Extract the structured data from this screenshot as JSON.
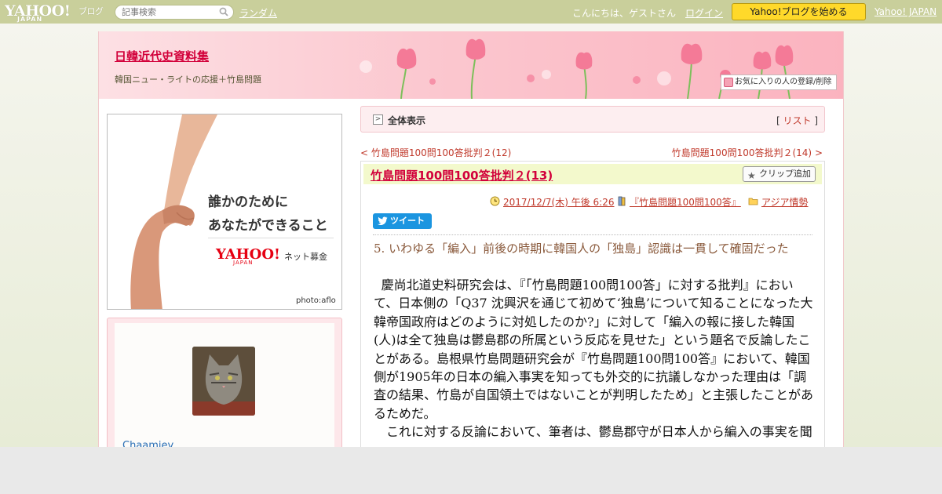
{
  "topbar": {
    "logo_main": "YAHOO!",
    "logo_sub": "JAPAN",
    "logo_service": "ブログ",
    "search_placeholder": "記事検索",
    "random_link": "ランダム",
    "greeting": "こんにちは、ゲストさん",
    "login_link": "ログイン",
    "start_button": "Yahoo!ブログを始める",
    "yahoo_japan_link": "Yahoo! JAPAN"
  },
  "blog": {
    "title": "日韓近代史資料集",
    "description": "韓国ニュー・ライトの応援＋竹島問題",
    "favorite_button": "お気に入りの人の登録/削除"
  },
  "sidebar": {
    "ad": {
      "line1": "誰かのために",
      "line2": "あなたができること",
      "brand": "YAHOO!",
      "brand_sub": "JAPAN",
      "brand_tail": "ネット募金",
      "credit": "photo:aflo"
    },
    "profile": {
      "name": "Chaamiey"
    }
  },
  "breadcrumb": {
    "label": "全体表示",
    "list_open": "[ ",
    "list_link": "リスト",
    "list_close": " ]"
  },
  "nav": {
    "prev_arrow": "< ",
    "prev_title": "竹島問題100問100答批判２(12)",
    "next_title": "竹島問題100問100答批判２(14)",
    "next_arrow": " >"
  },
  "article": {
    "title": "竹島問題100問100答批判２(13)",
    "clip_button": "クリップ追加",
    "date": "2017/12/7(木) 午後 6:26",
    "book": "『竹島問題100問100答』",
    "category": "アジア情勢",
    "tweet_button": "ツイート",
    "heading": "5. いわゆる「編入」前後の時期に韓国人の「独島」認識は一貫して確固だった",
    "paragraphs": [
      "慶尚北道史料研究会は、『「竹島問題100問100答」に対する批判』において、日本側の「Q37 沈興沢を通じて初めて‘独島’について知ることになった大韓帝国政府はどのように対処したのか?」に対して「編入の報に接した韓国(人)は全て独島は鬱島郡の所属という反応を見せた」という題名で反論したことがある。島根県竹島問題研究会が『竹島問題100問100答』において、韓国側が1905年の日本の編入事実を知っても外交的に抗議しなかった理由は「調査の結果、竹島が自国領土ではないことが判明したため」と主張したことがあるためだ。",
      "これに対する反論において、筆者は、鬱島郡守が日本人から編入の事実を聞"
    ]
  },
  "colors": {
    "topbar": "#c9cf9b",
    "accent_link": "#c0392b",
    "title_red": "#d2003a",
    "start_button": "#ffd92a",
    "tweet_blue": "#1b95e0"
  }
}
